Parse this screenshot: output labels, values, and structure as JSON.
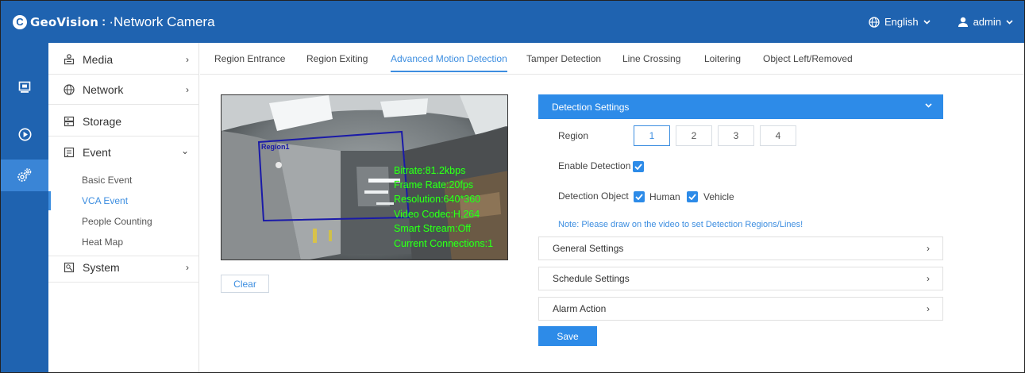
{
  "header": {
    "brand_logo": "GeoVision",
    "brand_separator": ":",
    "product": "·Network Camera",
    "language": "English",
    "user": "admin",
    "accent_color": "#1f63b0"
  },
  "rail": {
    "items": [
      {
        "icon": "monitor-icon",
        "active": false
      },
      {
        "icon": "playback-icon",
        "active": false
      },
      {
        "icon": "settings-gears-icon",
        "active": true
      }
    ]
  },
  "sidebar": {
    "items": [
      {
        "label": "Media",
        "icon": "media-icon",
        "chevron": "›"
      },
      {
        "label": "Network",
        "icon": "globe-icon",
        "chevron": "›"
      },
      {
        "label": "Storage",
        "icon": "storage-icon",
        "chevron": ""
      },
      {
        "label": "Event",
        "icon": "event-icon",
        "chevron": "⌄"
      },
      {
        "label": "System",
        "icon": "system-icon",
        "chevron": "›"
      }
    ],
    "event_sub": [
      {
        "label": "Basic Event",
        "active": false
      },
      {
        "label": "VCA Event",
        "active": true
      },
      {
        "label": "People Counting",
        "active": false
      },
      {
        "label": "Heat Map",
        "active": false
      }
    ]
  },
  "tabs": [
    {
      "label": "Region Entrance",
      "active": false
    },
    {
      "label": "Region Exiting",
      "active": false
    },
    {
      "label": "Advanced Motion Detection",
      "active": true
    },
    {
      "label": "Tamper Detection",
      "active": false
    },
    {
      "label": "Line Crossing",
      "active": false
    },
    {
      "label": "Loitering",
      "active": false
    },
    {
      "label": "Object Left/Removed",
      "active": false
    }
  ],
  "video": {
    "region_label": "Region1",
    "osd": [
      "Bitrate:81.2kbps",
      "Frame Rate:20fps",
      "Resolution:640*360",
      "Video Codec:H.264",
      "Smart Stream:Off",
      "Current Connections:1"
    ]
  },
  "clear_label": "Clear",
  "detection": {
    "header": "Detection Settings",
    "region_label": "Region",
    "regions": [
      "1",
      "2",
      "3",
      "4"
    ],
    "selected_region": "1",
    "enable_label": "Enable Detection",
    "enable_checked": true,
    "object_label": "Detection Object",
    "human_label": "Human",
    "human_checked": true,
    "vehicle_label": "Vehicle",
    "vehicle_checked": true,
    "note": "Note: Please draw on the video to set Detection Regions/Lines!"
  },
  "accordions": [
    {
      "label": "General Settings"
    },
    {
      "label": "Schedule Settings"
    },
    {
      "label": "Alarm Action"
    }
  ],
  "save_label": "Save"
}
